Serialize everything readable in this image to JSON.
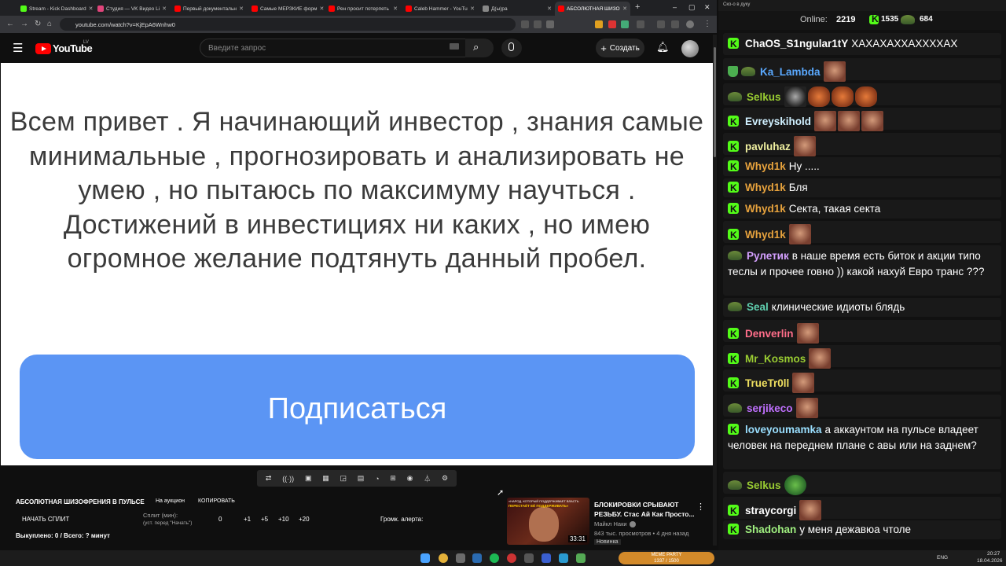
{
  "browser": {
    "tabs": [
      {
        "label": "Stream - Kick Dashboard",
        "color": "#53fc18"
      },
      {
        "label": "Студия — VK Видео Li",
        "color": "#e0457b"
      },
      {
        "label": "Первый документальн",
        "color": "#ff0000"
      },
      {
        "label": "Самые МЕРЗКИЕ форм",
        "color": "#ff0000"
      },
      {
        "label": "Рен просит потерпеть",
        "color": "#ff0000"
      },
      {
        "label": "Caleb Hammer - YouTu",
        "color": "#ff0000"
      },
      {
        "label": "Д(ы)ра",
        "color": "#888888"
      },
      {
        "label": "АБСОЛЮТНАЯ ШИЗО",
        "color": "#ff0000"
      }
    ],
    "new_tab": "+",
    "url": "youtube.com/watch?v=KjEpA6Wnhw0"
  },
  "youtube": {
    "logo_text": "YouTube",
    "country": "LV",
    "search_placeholder": "Введите запрос",
    "create_label": "Создать"
  },
  "video": {
    "text": "Всем привет . Я начинающий инвестор , знания самые минимальные , прогнозировать и анализировать не умею , но пытаюсь по максимуму научться . Достижений в инвестициях ни каких , но имею огромное желание подтянуть данный пробел.",
    "subscribe": "Подписаться"
  },
  "auction": {
    "title": "АБСОЛЮТНАЯ ШИЗОФРЕНИЯ В ПУЛЬСЕ",
    "on_auction": "На аукцион",
    "copy": "КОПИРОВАТЬ",
    "start_split": "НАЧАТЬ СПЛИТ",
    "split_label": "Сплит (мин):",
    "split_hint": "(уст. перед \"Начать\")",
    "split_value": "0",
    "increments": [
      "+1",
      "+5",
      "+10",
      "+20"
    ],
    "alert_label": "Громк. алерта:",
    "bought": "Выкуплено: 0 / Всего: ? минут"
  },
  "recommendation": {
    "thumb_caption": "«НАРОД, КОТОРЫЙ ПОДДЕРЖИВАЕТ ВЛАСТЬ",
    "thumb_caption2": "ПЕРЕСТАЁТ ЕЁ ПОДДЕРЖИВАТЬ»",
    "duration": "33:31",
    "title_line1": "БЛОКИРОВКИ СРЫВАЮТ",
    "title_line2": "РЕЗЬБУ. Стас Ай Как Просто...",
    "channel": "Майкл Наки",
    "meta": "843 тыс. просмотров • 4 дня назад",
    "badge": "Новинка"
  },
  "taskbar": {
    "meme_label": "MEME PARTY",
    "meme_progress": "1337 / 1500",
    "lang": "ENG",
    "time": "20:27",
    "date": "18.04.2026"
  },
  "chat_panel": {
    "window_title": "Ско-о в дуку",
    "online_label": "Online:",
    "online_count": "2219",
    "kick_count": "1535",
    "other_count": "684",
    "messages": [
      {
        "badge": "kick",
        "user": "ChaOS_S1ngular1tY",
        "color": "#ffffff",
        "text": "ХАХАХАХХАХХХХАХ",
        "emotes": 0
      },
      {
        "badge": "shield-hat",
        "user": "Ka_Lambda",
        "color": "#5aa9ff",
        "text": "",
        "emotes": 1
      },
      {
        "badge": "hat",
        "user": "Selkus",
        "color": "#9acd32",
        "text": "",
        "emotes": 4
      },
      {
        "badge": "kick",
        "user": "Evreyskihold",
        "color": "#d0f0ff",
        "text": "",
        "emotes": 3
      },
      {
        "badge": "kick",
        "user": "pavluhaz",
        "color": "#f0f0a0",
        "text": "",
        "emotes": 1
      },
      {
        "badge": "kick",
        "user": "Whyd1k",
        "color": "#e8a33d",
        "text": "Ну .....",
        "emotes": 0
      },
      {
        "badge": "kick",
        "user": "Whyd1k",
        "color": "#e8a33d",
        "text": "Бля",
        "emotes": 0
      },
      {
        "badge": "kick",
        "user": "Whyd1k",
        "color": "#e8a33d",
        "text": "Секта, такая секта",
        "emotes": 0
      },
      {
        "badge": "kick",
        "user": "Whyd1k",
        "color": "#e8a33d",
        "text": "",
        "emotes": 1
      },
      {
        "badge": "hat",
        "user": "Рулетик",
        "color": "#d4a0ff",
        "text": "в наше время есть биток и акции типо теслы и прочее говно )) какой нахуй Евро транс ???",
        "emotes": 0
      },
      {
        "badge": "hat",
        "user": "Seal",
        "color": "#60d0b0",
        "text": "клинические идиоты блядь",
        "emotes": 0
      },
      {
        "badge": "kick",
        "user": "Denverlin",
        "color": "#ff6e8a",
        "text": "",
        "emotes": 1
      },
      {
        "badge": "kick",
        "user": "Mr_Kosmos",
        "color": "#9acd32",
        "text": "",
        "emotes": 1
      },
      {
        "badge": "kick",
        "user": "TrueTr0ll",
        "color": "#f0e060",
        "text": "",
        "emotes": 1
      },
      {
        "badge": "hat",
        "user": "serjikeco",
        "color": "#c070ff",
        "text": "",
        "emotes": 1
      },
      {
        "badge": "kick",
        "user": "loveyoumamka",
        "color": "#9adfff",
        "text": "а аккаунтом на пульсе владеет человек на переднем плане с авы или на заднем?",
        "emotes": 0
      },
      {
        "badge": "hat",
        "user": "Selkus",
        "color": "#9acd32",
        "text": "",
        "emotes": 1
      },
      {
        "badge": "kick",
        "user": "straycorgi",
        "color": "#ffffff",
        "text": "",
        "emotes": 1
      },
      {
        "badge": "kick",
        "user": "Shadohan",
        "color": "#a0f080",
        "text": "у меня дежавюа чтоле",
        "emotes": 0
      }
    ]
  }
}
